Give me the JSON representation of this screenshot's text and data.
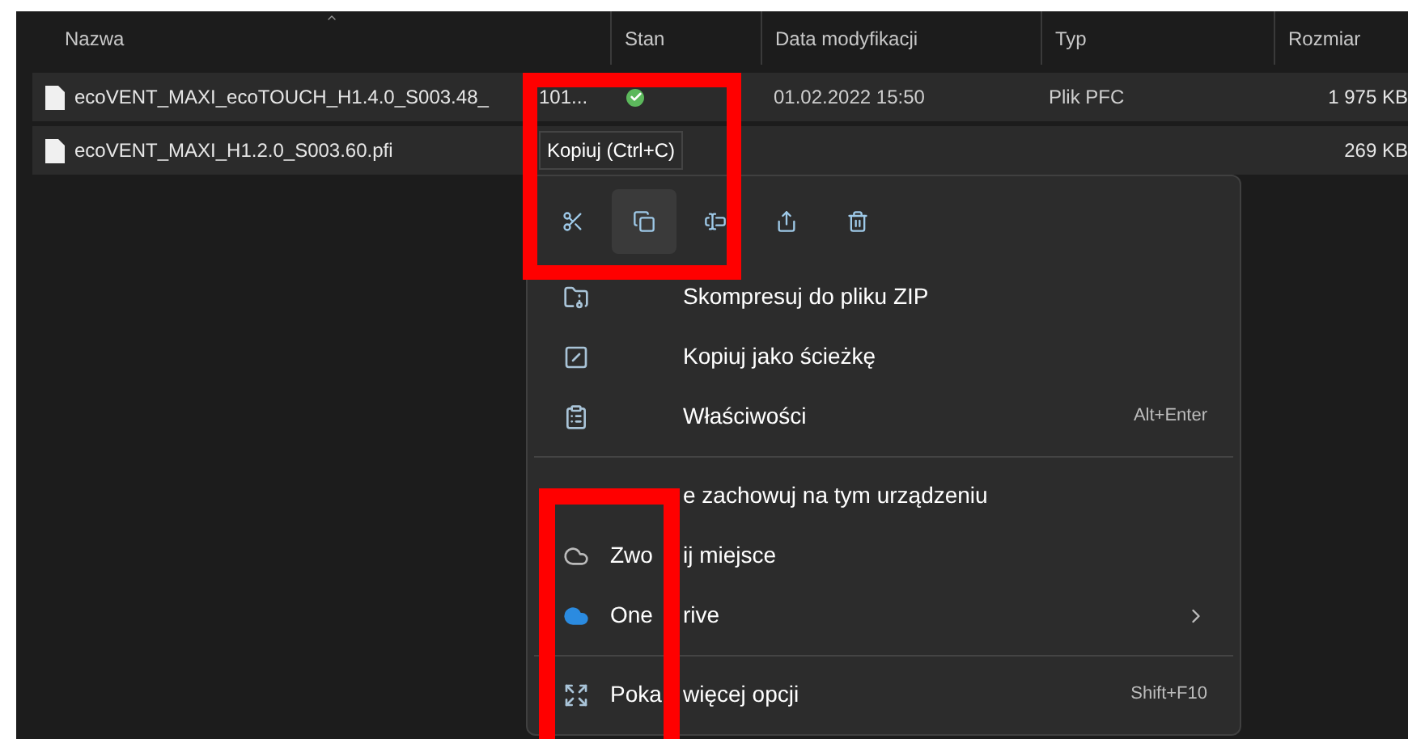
{
  "table": {
    "columns": [
      "Nazwa",
      "Stan",
      "Data modyfikacji",
      "Typ",
      "Rozmiar"
    ],
    "rows": [
      {
        "name_before": "ecoVENT_MAXI_ecoTOUCH_H1.4.0_S003.48_",
        "name_after": "101...",
        "synced": true,
        "modified": "01.02.2022 15:50",
        "type": "Plik PFC",
        "size": "1 975 KB"
      },
      {
        "name_before": "ecoVENT_MAXI_H1.2.0_S003.60.pfi",
        "size": "269 KB"
      }
    ]
  },
  "tooltip": "Kopiuj (Ctrl+C)",
  "context_menu": {
    "toolbar": [
      {
        "kind": "cut",
        "hovered": false
      },
      {
        "kind": "copy",
        "hovered": true
      },
      {
        "kind": "rename",
        "hovered": false
      },
      {
        "kind": "share",
        "hovered": false
      },
      {
        "kind": "delete",
        "hovered": false
      }
    ],
    "items": [
      {
        "kind": "item",
        "label_after": "Skompresuj do pliku ZIP"
      },
      {
        "kind": "item",
        "label_after": "Kopiuj jako ścieżkę"
      },
      {
        "kind": "item",
        "label_after": "Właściwości",
        "shortcut": "Alt+Enter"
      },
      {
        "kind": "divider"
      },
      {
        "kind": "item",
        "label_after": "e zachowuj na tym urządzeniu"
      },
      {
        "kind": "item",
        "label_before": "Zwo",
        "label_after": "ij miejsce"
      },
      {
        "kind": "item",
        "label_before": "One",
        "label_after": "rive",
        "submenu": true
      },
      {
        "kind": "divider"
      },
      {
        "kind": "item",
        "label_before": "Poka",
        "label_after": "więcej opcji",
        "shortcut": "Shift+F10"
      }
    ]
  }
}
